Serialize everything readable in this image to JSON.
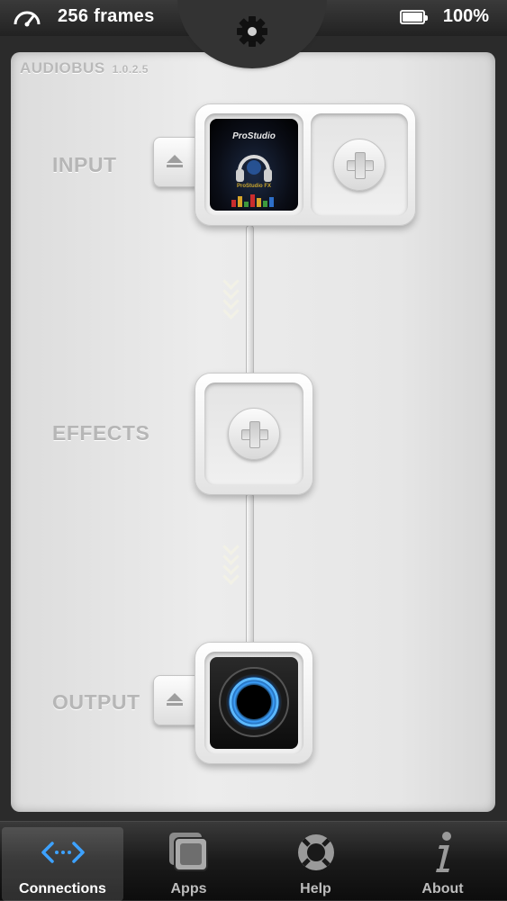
{
  "status_bar": {
    "frames": "256 frames",
    "battery": "100%"
  },
  "brand": {
    "name": "AUDIOBUS",
    "version": "1.0.2.5"
  },
  "slots": {
    "input": {
      "label": "INPUT",
      "app_title": "ProStudio",
      "app_subtitle": "ProStudio FX"
    },
    "effects": {
      "label": "EFFECTS"
    },
    "output": {
      "label": "OUTPUT"
    }
  },
  "tabs": [
    {
      "label": "Connections",
      "icon": "connections-icon",
      "active": true
    },
    {
      "label": "Apps",
      "icon": "apps-icon",
      "active": false
    },
    {
      "label": "Help",
      "icon": "lifebuoy-icon",
      "active": false
    },
    {
      "label": "About",
      "icon": "info-icon",
      "active": false
    }
  ],
  "colors": {
    "accent_blue": "#3da2ff",
    "panel_bg": "#e6e6e6",
    "label_gray": "#b6b6b6"
  }
}
